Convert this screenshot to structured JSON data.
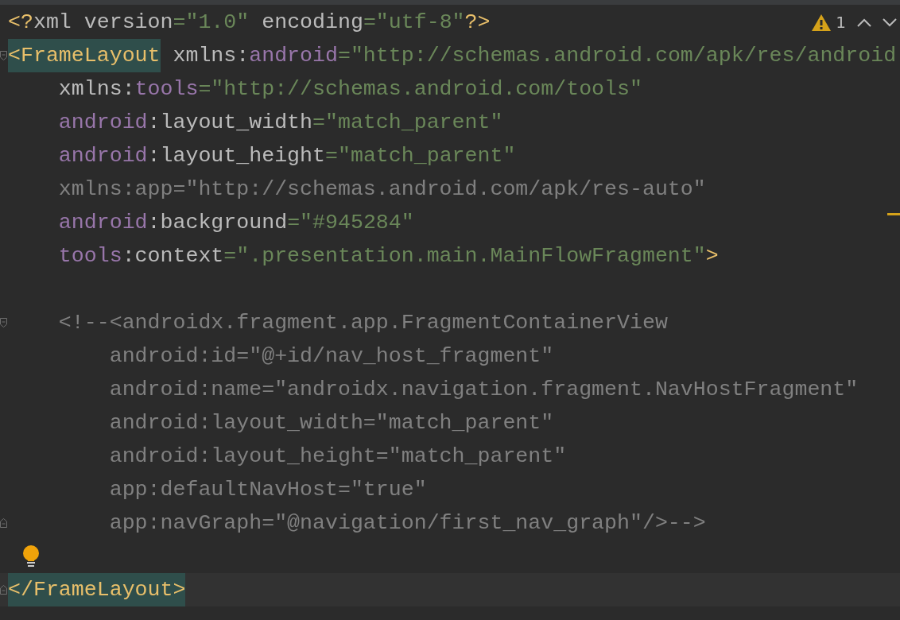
{
  "problems": {
    "count": "1"
  },
  "sections": [
    [
      {
        "tokens": [
          {
            "kind": "tag",
            "text": "<?"
          },
          {
            "kind": "text",
            "text": "xml version"
          },
          {
            "kind": "value",
            "text": "=\"1.0\""
          },
          {
            "kind": "text",
            "text": " encoding"
          },
          {
            "kind": "value",
            "text": "=\"utf-8\""
          },
          {
            "kind": "tag",
            "text": "?>"
          }
        ]
      },
      {
        "fold_start": true,
        "tokens": [
          {
            "kind": "tag",
            "text": "<FrameLayout",
            "highlighted": true
          },
          {
            "kind": "text",
            "text": " xmlns:"
          },
          {
            "kind": "ns",
            "text": "android"
          },
          {
            "kind": "value",
            "text": "=\"http://schemas.android.com/apk/res/android"
          }
        ]
      },
      {
        "tokens": [
          {
            "kind": "text",
            "text": "    xmlns:"
          },
          {
            "kind": "ns",
            "text": "tools"
          },
          {
            "kind": "value",
            "text": "=\"http://schemas.android.com/tools\""
          }
        ]
      },
      {
        "tokens": [
          {
            "kind": "ns",
            "text": "    android"
          },
          {
            "kind": "text",
            "text": ":layout_width"
          },
          {
            "kind": "value",
            "text": "=\"match_parent\""
          }
        ]
      },
      {
        "tokens": [
          {
            "kind": "ns",
            "text": "    android"
          },
          {
            "kind": "text",
            "text": ":layout_height"
          },
          {
            "kind": "value",
            "text": "=\"match_parent\""
          }
        ]
      },
      {
        "tokens": [
          {
            "kind": "comment",
            "text": "    xmlns:app=\"http://schemas.android.com/apk/res-auto\""
          }
        ]
      },
      {
        "tokens": [
          {
            "kind": "ns",
            "text": "    android"
          },
          {
            "kind": "text",
            "text": ":background"
          },
          {
            "kind": "value",
            "text": "=\"#945284\""
          }
        ]
      },
      {
        "tokens": [
          {
            "kind": "ns",
            "text": "    tools"
          },
          {
            "kind": "text",
            "text": ":context"
          },
          {
            "kind": "value",
            "text": "=\".presentation.main.MainFlowFragment\""
          },
          {
            "kind": "tag",
            "text": ">"
          }
        ]
      }
    ],
    [
      {
        "fold_start": true,
        "tokens": [
          {
            "kind": "comment",
            "text": "    <!--<androidx.fragment.app.FragmentContainerView"
          }
        ]
      },
      {
        "tokens": [
          {
            "kind": "comment",
            "text": "        android:id=\"@+id/nav_host_fragment\""
          }
        ]
      },
      {
        "tokens": [
          {
            "kind": "comment",
            "text": "        android:name=\"androidx.navigation.fragment.NavHostFragment\""
          }
        ]
      },
      {
        "tokens": [
          {
            "kind": "comment",
            "text": "        android:layout_width=\"match_parent\""
          }
        ]
      },
      {
        "tokens": [
          {
            "kind": "comment",
            "text": "        android:layout_height=\"match_parent\""
          }
        ]
      },
      {
        "tokens": [
          {
            "kind": "comment",
            "text": "        app:defaultNavHost=\"true\""
          }
        ]
      },
      {
        "fold_end": true,
        "tokens": [
          {
            "kind": "comment",
            "text": "        app:navGraph=\"@navigation/first_nav_graph\"/>-->"
          }
        ]
      },
      {
        "bulb": true
      },
      {
        "fold_end": true,
        "current": true,
        "tokens": [
          {
            "kind": "tag",
            "text": "</FrameLayout>",
            "highlighted": true
          }
        ]
      }
    ]
  ]
}
